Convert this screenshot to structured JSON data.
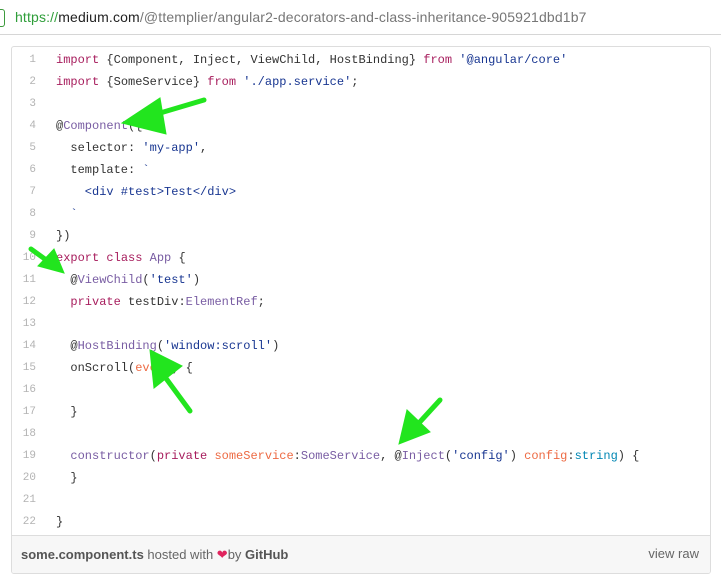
{
  "browser": {
    "url_scheme": "https://",
    "url_host": "medium.com",
    "url_path": "/@ttemplier/angular2-decorators-and-class-inheritance-905921dbd1b7"
  },
  "code_lines": [
    [
      {
        "t": "import",
        "c": "kw"
      },
      {
        "t": " {Component, Inject, ViewChild, HostBinding} ",
        "c": ""
      },
      {
        "t": "from",
        "c": "kw"
      },
      {
        "t": " ",
        "c": ""
      },
      {
        "t": "'@angular/core'",
        "c": "str"
      }
    ],
    [
      {
        "t": "import",
        "c": "kw"
      },
      {
        "t": " {SomeService} ",
        "c": ""
      },
      {
        "t": "from",
        "c": "kw"
      },
      {
        "t": " ",
        "c": ""
      },
      {
        "t": "'./app.service'",
        "c": "str"
      },
      {
        "t": ";",
        "c": ""
      }
    ],
    [],
    [
      {
        "t": "@",
        "c": ""
      },
      {
        "t": "Component",
        "c": "dec"
      },
      {
        "t": "({",
        "c": ""
      }
    ],
    [
      {
        "t": "  selector: ",
        "c": ""
      },
      {
        "t": "'my-app'",
        "c": "str"
      },
      {
        "t": ",",
        "c": ""
      }
    ],
    [
      {
        "t": "  template: ",
        "c": ""
      },
      {
        "t": "`",
        "c": "str"
      }
    ],
    [
      {
        "t": "    <div #test>Test</div>",
        "c": "str"
      }
    ],
    [
      {
        "t": "  `",
        "c": "str"
      }
    ],
    [
      {
        "t": "})",
        "c": ""
      }
    ],
    [
      {
        "t": "export",
        "c": "kw"
      },
      {
        "t": " ",
        "c": ""
      },
      {
        "t": "class",
        "c": "kw"
      },
      {
        "t": " ",
        "c": ""
      },
      {
        "t": "App",
        "c": "dec"
      },
      {
        "t": " {",
        "c": ""
      }
    ],
    [
      {
        "t": "  @",
        "c": ""
      },
      {
        "t": "ViewChild",
        "c": "dec"
      },
      {
        "t": "(",
        "c": ""
      },
      {
        "t": "'test'",
        "c": "str"
      },
      {
        "t": ")",
        "c": ""
      }
    ],
    [
      {
        "t": "  ",
        "c": ""
      },
      {
        "t": "private",
        "c": "kw"
      },
      {
        "t": " testDiv:",
        "c": ""
      },
      {
        "t": "ElementRef",
        "c": "dec"
      },
      {
        "t": ";",
        "c": ""
      }
    ],
    [],
    [
      {
        "t": "  @",
        "c": ""
      },
      {
        "t": "HostBinding",
        "c": "dec"
      },
      {
        "t": "(",
        "c": ""
      },
      {
        "t": "'window:scroll'",
        "c": "str"
      },
      {
        "t": ")",
        "c": ""
      }
    ],
    [
      {
        "t": "  onScroll(",
        "c": ""
      },
      {
        "t": "event",
        "c": "param"
      },
      {
        "t": ") {",
        "c": ""
      }
    ],
    [],
    [
      {
        "t": "  }",
        "c": ""
      }
    ],
    [],
    [
      {
        "t": "  ",
        "c": ""
      },
      {
        "t": "constructor",
        "c": "dec"
      },
      {
        "t": "(",
        "c": ""
      },
      {
        "t": "private",
        "c": "kw"
      },
      {
        "t": " ",
        "c": ""
      },
      {
        "t": "someService",
        "c": "param"
      },
      {
        "t": ":",
        "c": ""
      },
      {
        "t": "SomeService",
        "c": "dec"
      },
      {
        "t": ", @",
        "c": ""
      },
      {
        "t": "Inject",
        "c": "dec"
      },
      {
        "t": "(",
        "c": ""
      },
      {
        "t": "'config'",
        "c": "str"
      },
      {
        "t": ") ",
        "c": ""
      },
      {
        "t": "config",
        "c": "param"
      },
      {
        "t": ":",
        "c": ""
      },
      {
        "t": "string",
        "c": "typ"
      },
      {
        "t": ") {",
        "c": ""
      }
    ],
    [
      {
        "t": "  }",
        "c": ""
      }
    ],
    [],
    [
      {
        "t": "}",
        "c": ""
      }
    ]
  ],
  "footer": {
    "filename": "some.component.ts",
    "hosted_with": " hosted with ",
    "heart": "❤",
    "by": "by ",
    "host": "GitHub",
    "view_raw": "view raw"
  },
  "colors": {
    "keyword": "#a71d5d",
    "string": "#183691",
    "entity": "#795da3",
    "param": "#ed6a43",
    "type": "#0086b3",
    "arrow": "#22e51e"
  },
  "annotations": {
    "arrow_color": "#22e51e",
    "arrow_count": 4
  }
}
